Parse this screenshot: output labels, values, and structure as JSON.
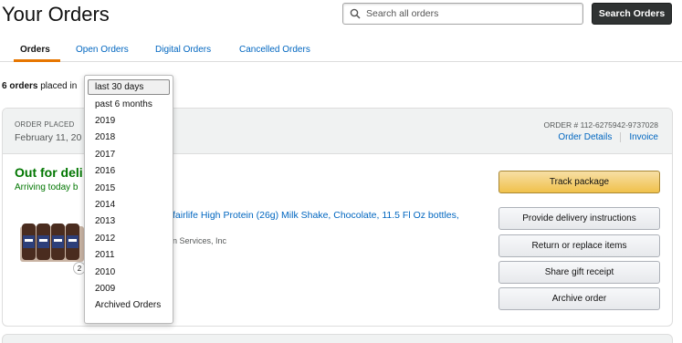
{
  "header": {
    "title": "Your Orders",
    "search_placeholder": "Search all orders",
    "search_button": "Search Orders"
  },
  "tabs": [
    {
      "label": "Orders",
      "active": true
    },
    {
      "label": "Open Orders",
      "active": false
    },
    {
      "label": "Digital Orders",
      "active": false
    },
    {
      "label": "Cancelled Orders",
      "active": false
    }
  ],
  "filter": {
    "count_bold": "6 orders",
    "count_rest": "placed in",
    "selected": "last 30 days",
    "options": [
      "last 30 days",
      "past 6 months",
      "2019",
      "2018",
      "2017",
      "2016",
      "2015",
      "2014",
      "2013",
      "2012",
      "2011",
      "2010",
      "2009",
      "Archived Orders"
    ]
  },
  "order": {
    "placed_label": "ORDER PLACED",
    "placed_date": "February 11, 20",
    "order_number": "ORDER # 112-6275942-9737028",
    "details_link": "Order Details",
    "invoice_link": "Invoice",
    "status": "Out for deli",
    "arriving": "Arriving today b",
    "product_title": "fairlife High Protein (26g) Milk Shake, Chocolate, 11.5 Fl Oz bottles,",
    "sold_by": "n Services, Inc",
    "quantity": "2",
    "buttons": {
      "track": "Track package",
      "delivery": "Provide delivery instructions",
      "return": "Return or replace items",
      "gift": "Share gift receipt",
      "archive": "Archive order"
    }
  },
  "colors": {
    "link": "#0066c0",
    "status_green": "#007600",
    "tab_underline": "#e77600",
    "primary_button": "#f0c14b",
    "search_button": "#303333"
  }
}
